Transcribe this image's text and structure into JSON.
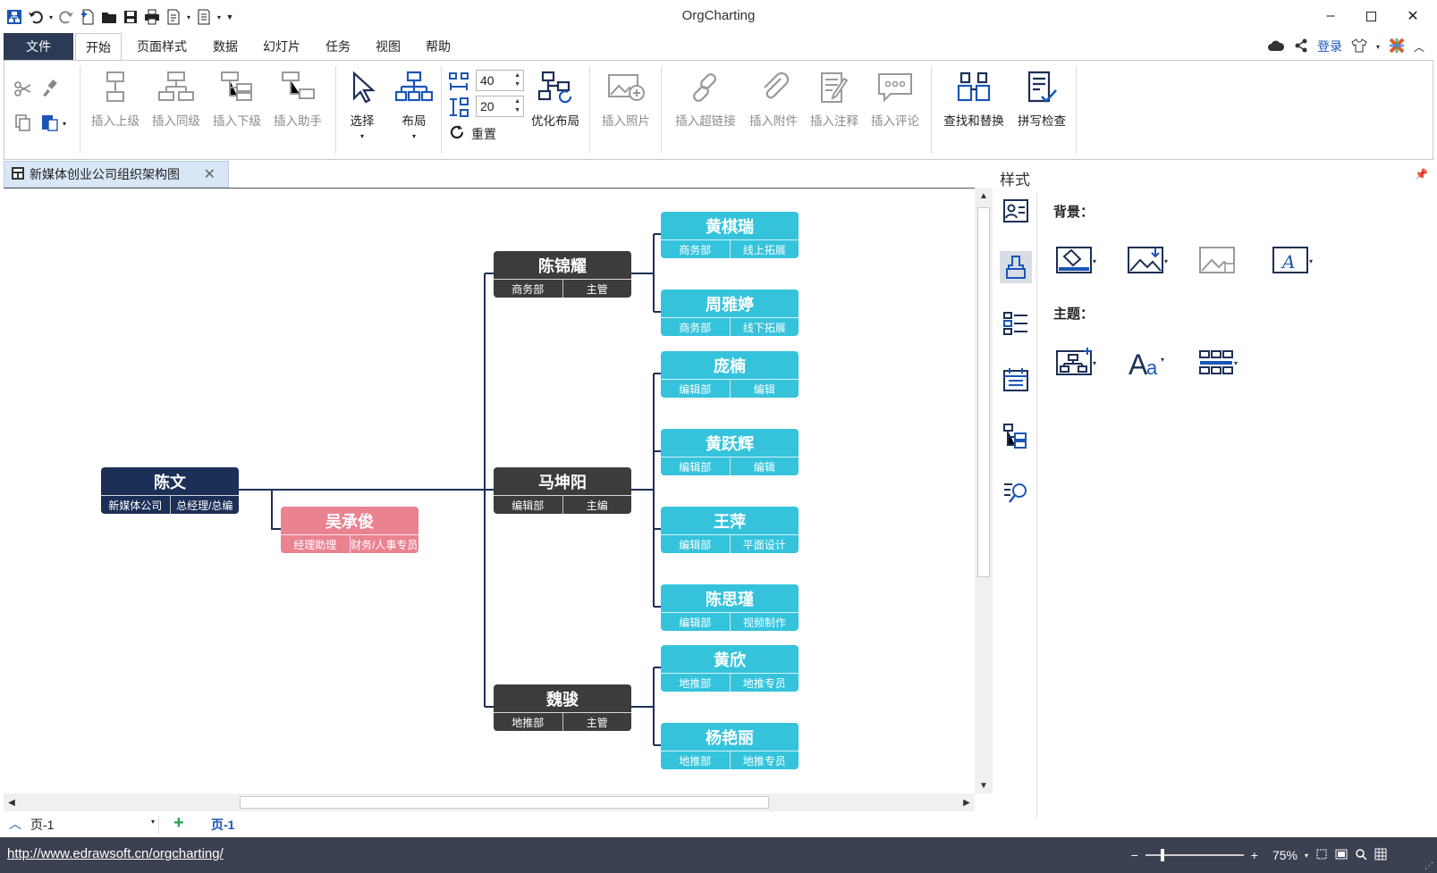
{
  "app": {
    "title": "OrgCharting"
  },
  "menu": {
    "file": "文件",
    "tabs": [
      "开始",
      "页面样式",
      "数据",
      "幻灯片",
      "任务",
      "视图",
      "帮助"
    ],
    "login": "登录"
  },
  "ribbon": {
    "insert_parent": "插入上级",
    "insert_sibling": "插入同级",
    "insert_child": "插入下级",
    "insert_assistant": "插入助手",
    "select": "选择",
    "layout": "布局",
    "spacing_h": "40",
    "spacing_v": "20",
    "reset": "重置",
    "optimize_layout": "优化布局",
    "insert_photo": "插入照片",
    "insert_hyperlink": "插入超链接",
    "insert_attachment": "插入附件",
    "insert_note": "插入注释",
    "insert_comment": "插入评论",
    "find_replace": "查找和替换",
    "spell_check": "拼写检查"
  },
  "document": {
    "tab_title": "新媒体创业公司组织架构图"
  },
  "org": {
    "root": {
      "name": "陈文",
      "dept": "新媒体公司",
      "role": "总经理/总编"
    },
    "assistant": {
      "name": "吴承俊",
      "dept": "经理助理",
      "role": "财务/人事专员"
    },
    "managers": [
      {
        "name": "陈锦耀",
        "dept": "商务部",
        "role": "主管"
      },
      {
        "name": "马坤阳",
        "dept": "编辑部",
        "role": "主编"
      },
      {
        "name": "魏骏",
        "dept": "地推部",
        "role": "主管"
      }
    ],
    "staff": [
      {
        "name": "黄棋瑞",
        "dept": "商务部",
        "role": "线上拓展"
      },
      {
        "name": "周雅婷",
        "dept": "商务部",
        "role": "线下拓展"
      },
      {
        "name": "庞楠",
        "dept": "编辑部",
        "role": "编辑"
      },
      {
        "name": "黄跃辉",
        "dept": "编辑部",
        "role": "编辑"
      },
      {
        "name": "王萍",
        "dept": "编辑部",
        "role": "平面设计"
      },
      {
        "name": "陈思瑾",
        "dept": "编辑部",
        "role": "视频制作"
      },
      {
        "name": "黄欣",
        "dept": "地推部",
        "role": "地推专员"
      },
      {
        "name": "杨艳丽",
        "dept": "地推部",
        "role": "地推专员"
      }
    ],
    "colors": {
      "root": "#1c2f56",
      "manager": "#3c3c3c",
      "staff": "#35c3dc",
      "assistant": "#ea8290",
      "connector": "#1c2f56"
    }
  },
  "panel": {
    "title": "样式",
    "background_label": "背景：",
    "theme_label": "主题："
  },
  "pages": {
    "selector": "页-1",
    "active_tab": "页-1"
  },
  "status": {
    "url": "http://www.edrawsoft.cn/orgcharting/",
    "zoom": "75%"
  }
}
